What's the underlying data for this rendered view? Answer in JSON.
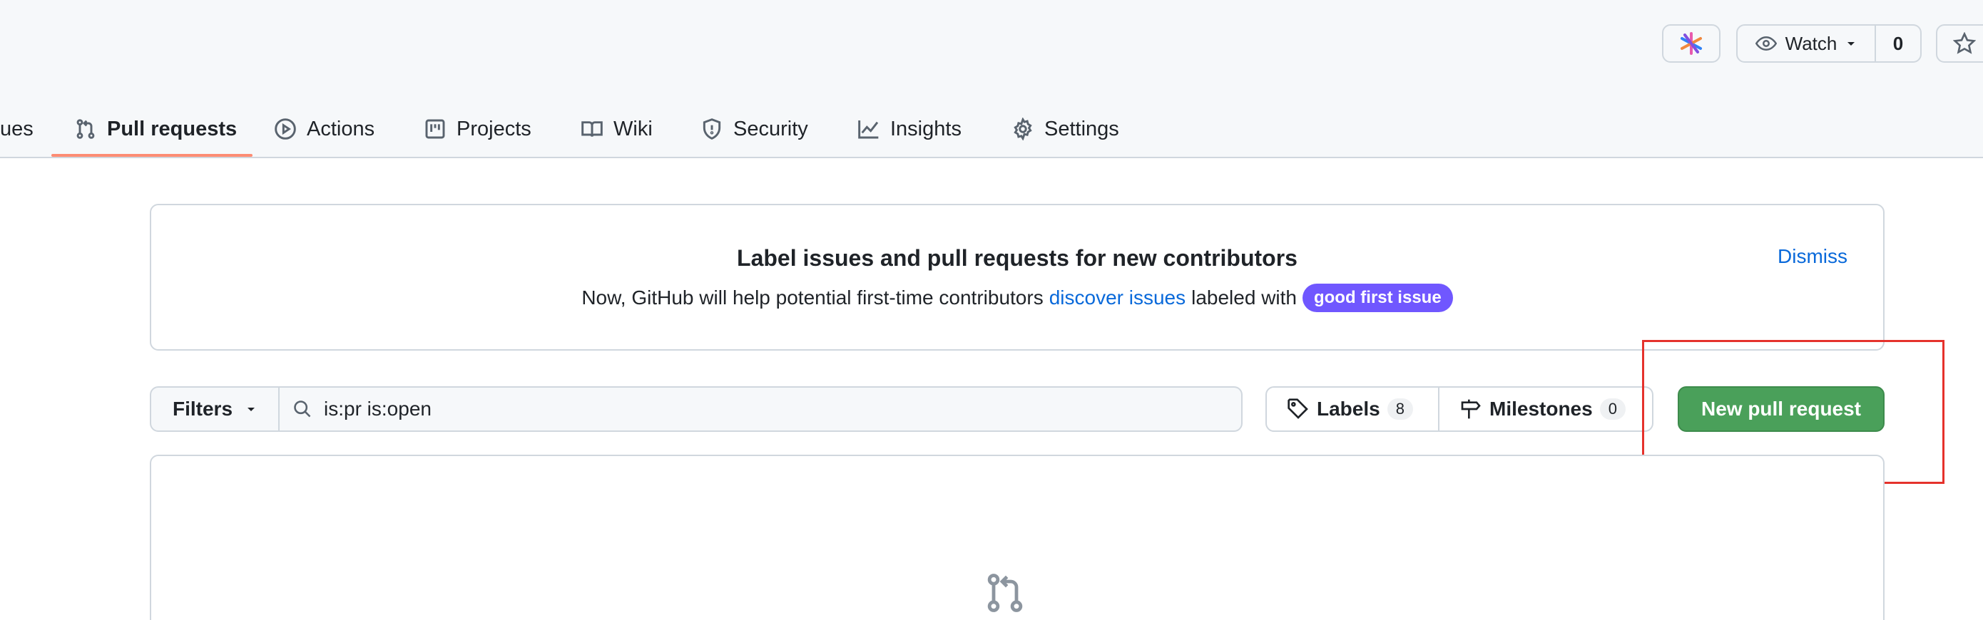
{
  "top_actions": {
    "watch_label": "Watch",
    "watch_count": "0"
  },
  "tabs": [
    {
      "label": "ues"
    },
    {
      "label": "Pull requests"
    },
    {
      "label": "Actions"
    },
    {
      "label": "Projects"
    },
    {
      "label": "Wiki"
    },
    {
      "label": "Security"
    },
    {
      "label": "Insights"
    },
    {
      "label": "Settings"
    }
  ],
  "banner": {
    "title": "Label issues and pull requests for new contributors",
    "text_before": "Now, GitHub will help potential first-time contributors",
    "link": "discover issues",
    "text_after": "labeled with",
    "pill": "good first issue",
    "dismiss": "Dismiss"
  },
  "filters": {
    "button": "Filters",
    "search_value": "is:pr is:open"
  },
  "labels": {
    "label": "Labels",
    "count": "8"
  },
  "milestones": {
    "label": "Milestones",
    "count": "0"
  },
  "new_pr": "New pull request",
  "colors": {
    "accent_underline": "#fd8c73",
    "primary_green": "#4aa05a",
    "pill_purple": "#7057ff",
    "highlight_red": "#e5322c",
    "link_blue": "#0969da"
  }
}
